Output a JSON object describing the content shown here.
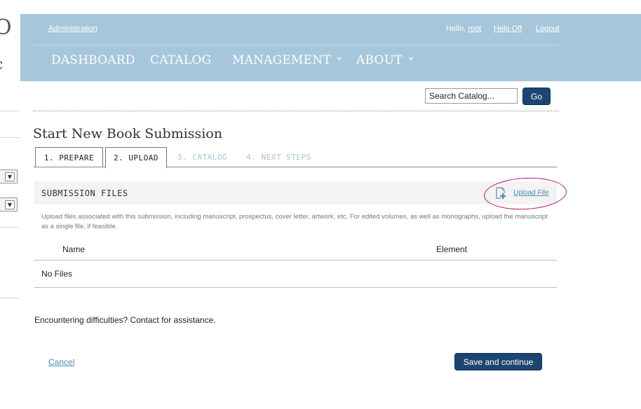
{
  "sidebar_partial": {
    "glyph_top": "O",
    "glyph_bottom": "c"
  },
  "header": {
    "admin_link": "Administration",
    "hello_text": "Hello,",
    "username": "root",
    "help_link": "Help Off",
    "logout_link": "Logout",
    "nav": [
      {
        "label": "DASHBOARD",
        "has_dropdown": false
      },
      {
        "label": "CATALOG",
        "has_dropdown": false
      },
      {
        "label": "MANAGEMENT",
        "has_dropdown": true
      },
      {
        "label": "ABOUT",
        "has_dropdown": true
      }
    ],
    "background_color": "#a6c6dc"
  },
  "search": {
    "placeholder": "Search Catalog...",
    "value": "Search Catalog...",
    "button_label": "Go"
  },
  "page_title": "Start New Book Submission",
  "tabs": [
    {
      "label": "1. PREPARE",
      "state": "enabled"
    },
    {
      "label": "2. UPLOAD",
      "state": "active"
    },
    {
      "label": "3. CATALOG",
      "state": "disabled"
    },
    {
      "label": "4. NEXT STEPS",
      "state": "disabled"
    }
  ],
  "files": {
    "title": "SUBMISSION FILES",
    "upload_icon": "file-add-icon",
    "upload_link": "Upload File",
    "description": "Upload files associated with this submission, including manuscript, prospectus, cover letter, artwork, etc. For edited volumes, as well as monographs, upload the manuscript as a single file, if feasible.",
    "columns": [
      "Name",
      "Element"
    ],
    "empty_text": "No Files"
  },
  "help_text": "Encountering difficulties? Contact for assistance.",
  "actions": {
    "cancel_label": "Cancel",
    "save_label": "Save and continue"
  },
  "colors": {
    "button": "#1c466f",
    "link": "#4a8bb8",
    "annotation_circle": "#b3186f"
  }
}
